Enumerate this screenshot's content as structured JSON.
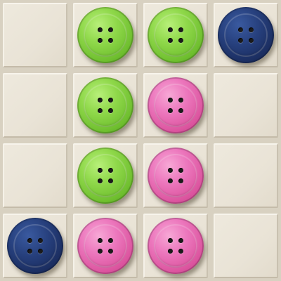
{
  "board": {
    "rows": 4,
    "cols": 4,
    "grid": [
      [
        "empty",
        "green",
        "green",
        "navy"
      ],
      [
        "empty",
        "green",
        "pink",
        "empty"
      ],
      [
        "empty",
        "green",
        "pink",
        "empty"
      ],
      [
        "navy",
        "pink",
        "pink",
        "empty"
      ]
    ]
  },
  "colors": {
    "board": "#d8d1c1",
    "cell": "#ebe5d8",
    "green": "#8fd84a",
    "pink": "#ec77bd",
    "navy": "#263f7c"
  },
  "icons": {
    "green": "green-button-piece-icon",
    "pink": "pink-button-piece-icon",
    "navy": "navy-button-piece-icon"
  }
}
